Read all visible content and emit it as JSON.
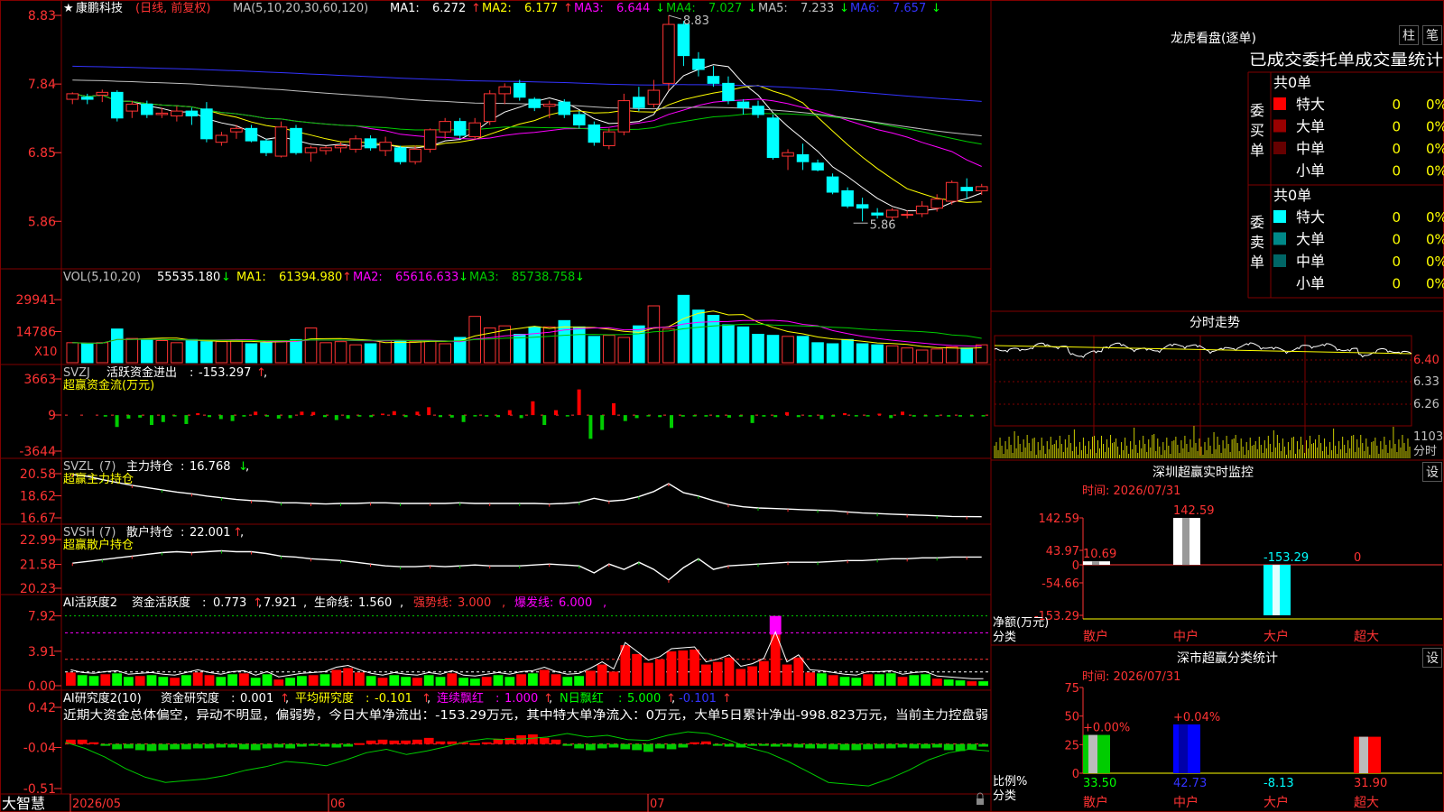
{
  "chart_data": [
    {
      "type": "candlestick",
      "title": "康鹏科技",
      "subtitle": "(日线, 前复权)",
      "legend_prefix": "MA(5,10,20,30,60,120)",
      "ma": [
        {
          "name": "MA1",
          "value": "6.272",
          "dir": "↑",
          "color": "#ffffff"
        },
        {
          "name": "MA2",
          "value": "6.177",
          "dir": "↑",
          "color": "#ffff00"
        },
        {
          "name": "MA3",
          "value": "6.644",
          "dir": "↓",
          "color": "#ff00ff"
        },
        {
          "name": "MA4",
          "value": "7.027",
          "dir": "↓",
          "color": "#00cc00"
        },
        {
          "name": "MA5",
          "value": "7.233",
          "dir": "↓",
          "color": "#c0c0c0"
        },
        {
          "name": "MA6",
          "value": "7.657",
          "dir": "↓",
          "color": "#3333ff"
        }
      ],
      "ylim": [
        5.2,
        9.0
      ],
      "yticks": [
        "8.83",
        "7.84",
        "6.85",
        "5.86"
      ],
      "high_label": "8.83",
      "low_label": "5.86",
      "x_labels": [
        "2026/05",
        "06",
        "07"
      ],
      "candles": [
        [
          7.62,
          7.72,
          7.55,
          7.7
        ],
        [
          7.65,
          7.7,
          7.55,
          7.62
        ],
        [
          7.68,
          7.76,
          7.58,
          7.72
        ],
        [
          7.72,
          7.75,
          7.3,
          7.35
        ],
        [
          7.45,
          7.6,
          7.35,
          7.55
        ],
        [
          7.55,
          7.6,
          7.35,
          7.4
        ],
        [
          7.4,
          7.5,
          7.35,
          7.42
        ],
        [
          7.38,
          7.52,
          7.3,
          7.45
        ],
        [
          7.45,
          7.5,
          7.25,
          7.38
        ],
        [
          7.48,
          7.58,
          7.0,
          7.05
        ],
        [
          7.0,
          7.15,
          6.95,
          7.1
        ],
        [
          7.15,
          7.25,
          7.05,
          7.2
        ],
        [
          7.2,
          7.25,
          7.0,
          7.02
        ],
        [
          7.02,
          7.05,
          6.8,
          6.85
        ],
        [
          6.8,
          7.3,
          6.78,
          7.22
        ],
        [
          7.2,
          7.25,
          6.82,
          6.85
        ],
        [
          6.85,
          6.95,
          6.72,
          6.92
        ],
        [
          6.88,
          6.95,
          6.82,
          6.92
        ],
        [
          6.92,
          7.0,
          6.85,
          6.95
        ],
        [
          6.9,
          7.1,
          6.85,
          7.05
        ],
        [
          7.05,
          7.1,
          6.88,
          6.92
        ],
        [
          6.88,
          7.08,
          6.8,
          7.0
        ],
        [
          6.92,
          6.95,
          6.68,
          6.72
        ],
        [
          6.72,
          6.95,
          6.68,
          6.9
        ],
        [
          6.9,
          7.2,
          6.85,
          7.18
        ],
        [
          7.15,
          7.35,
          7.05,
          7.3
        ],
        [
          7.3,
          7.35,
          7.05,
          7.1
        ],
        [
          7.08,
          7.35,
          7.05,
          7.28
        ],
        [
          7.3,
          7.75,
          7.25,
          7.7
        ],
        [
          7.7,
          7.85,
          7.55,
          7.8
        ],
        [
          7.85,
          7.9,
          7.6,
          7.65
        ],
        [
          7.62,
          7.65,
          7.45,
          7.5
        ],
        [
          7.52,
          7.6,
          7.35,
          7.55
        ],
        [
          7.58,
          7.62,
          7.35,
          7.4
        ],
        [
          7.4,
          7.45,
          7.2,
          7.25
        ],
        [
          7.25,
          7.3,
          6.95,
          7.0
        ],
        [
          6.95,
          7.2,
          6.9,
          7.15
        ],
        [
          7.15,
          7.7,
          7.1,
          7.6
        ],
        [
          7.65,
          7.8,
          7.45,
          7.5
        ],
        [
          7.55,
          7.9,
          7.5,
          7.75
        ],
        [
          7.85,
          8.83,
          7.75,
          8.7
        ],
        [
          8.7,
          8.75,
          8.1,
          8.25
        ],
        [
          8.2,
          8.3,
          7.95,
          8.05
        ],
        [
          7.95,
          8.1,
          7.8,
          7.85
        ],
        [
          7.85,
          7.95,
          7.55,
          7.6
        ],
        [
          7.58,
          7.62,
          7.4,
          7.5
        ],
        [
          7.52,
          7.6,
          7.35,
          7.4
        ],
        [
          7.35,
          7.4,
          6.75,
          6.78
        ],
        [
          6.8,
          6.9,
          6.6,
          6.85
        ],
        [
          6.82,
          6.98,
          6.6,
          6.72
        ],
        [
          6.7,
          6.75,
          6.58,
          6.6
        ],
        [
          6.5,
          6.55,
          6.25,
          6.28
        ],
        [
          6.3,
          6.35,
          6.05,
          6.08
        ],
        [
          6.1,
          6.2,
          5.86,
          6.05
        ],
        [
          5.98,
          6.05,
          5.9,
          5.95
        ],
        [
          5.92,
          6.05,
          5.88,
          6.02
        ],
        [
          5.95,
          6.02,
          5.9,
          5.96
        ],
        [
          5.97,
          6.15,
          5.92,
          6.08
        ],
        [
          6.05,
          6.25,
          6.0,
          6.18
        ],
        [
          6.15,
          6.45,
          6.1,
          6.42
        ],
        [
          6.35,
          6.48,
          6.18,
          6.3
        ],
        [
          6.3,
          6.4,
          6.24,
          6.36
        ]
      ]
    },
    {
      "type": "bar",
      "title": "VOL(5,10,20)",
      "value": "55535.180",
      "value_dir": "↓",
      "ma": [
        {
          "name": "MA1",
          "value": "61394.980",
          "dir": "↑",
          "color": "#ffff00"
        },
        {
          "name": "MA2",
          "value": "65616.633",
          "dir": "↓",
          "color": "#ff00ff"
        },
        {
          "name": "MA3",
          "value": "85738.758",
          "dir": "↓",
          "color": "#00cc00"
        }
      ],
      "yticks": [
        "29941",
        "14786"
      ],
      "unit_label": "X10",
      "ylim": [
        0,
        36000
      ],
      "values": [
        9500,
        9000,
        9500,
        16000,
        11500,
        11000,
        10500,
        9500,
        11000,
        10000,
        10000,
        10500,
        9000,
        9500,
        10500,
        11000,
        16500,
        9500,
        10000,
        8500,
        9000,
        10500,
        10500,
        10000,
        10500,
        9000,
        12000,
        22000,
        16500,
        17500,
        13500,
        17000,
        17000,
        20000,
        17000,
        12500,
        13000,
        12000,
        17500,
        27000,
        16000,
        32000,
        25000,
        22500,
        18000,
        17000,
        13500,
        13000,
        12500,
        12500,
        9500,
        9000,
        11000,
        9000,
        8500,
        8000,
        7000,
        6000,
        6500,
        7500,
        7000,
        8500
      ]
    },
    {
      "type": "bar",
      "title": "SVZJ",
      "label": "活跃资金进出",
      "value": "-153.297",
      "value_dir": "↑",
      "subtitle": "超赢资金流(万元)",
      "yticks": [
        "3663",
        "9",
        "-3644"
      ],
      "ylim": [
        -3644,
        3663
      ],
      "values": [
        0,
        0,
        0,
        -150,
        -1200,
        -350,
        -250,
        -1000,
        -700,
        -100,
        -900,
        200,
        -200,
        -400,
        -600,
        -150,
        350,
        -150,
        -350,
        -300,
        350,
        320,
        -200,
        -500,
        -350,
        -150,
        -200,
        150,
        400,
        -200,
        350,
        800,
        -200,
        -250,
        -700,
        -100,
        -150,
        -200,
        500,
        -300,
        1400,
        -1000,
        500,
        -100,
        2600,
        -2400,
        -1500,
        1200,
        -600,
        -300,
        -100,
        -200,
        -1300,
        -150,
        -100,
        -150,
        -200,
        -250,
        -150,
        -800,
        -150,
        -200,
        300,
        -200,
        -150,
        -400,
        -150,
        200,
        -100,
        -100,
        150,
        -300,
        350,
        -150,
        -100,
        -100,
        -150,
        -150,
        -100,
        -100
      ]
    },
    {
      "type": "line",
      "title": "SVZL",
      "param": "(7)",
      "label": "主力持仓",
      "value": "16.768",
      "value_dir": "↓",
      "subtitle": "超赢主力持仓",
      "yticks": [
        "20.58",
        "18.62",
        "16.67"
      ],
      "ylim": [
        16.67,
        20.58
      ],
      "values": [
        20.5,
        20.35,
        20.05,
        19.8,
        19.55,
        19.35,
        19.15,
        18.95,
        18.8,
        18.6,
        18.45,
        18.3,
        18.2,
        18.15,
        18.0,
        18.0,
        17.95,
        17.9,
        17.95,
        17.95,
        18.0,
        18.0,
        17.95,
        17.95,
        17.95,
        17.95,
        18.0,
        17.95,
        17.95,
        17.95,
        17.95,
        17.95,
        17.9,
        17.95,
        18.05,
        18.4,
        18.15,
        18.25,
        18.55,
        19.0,
        19.7,
        18.9,
        18.6,
        18.2,
        17.85,
        17.65,
        17.55,
        17.5,
        17.45,
        17.4,
        17.35,
        17.3,
        17.2,
        17.1,
        17.05,
        17.0,
        16.95,
        16.9,
        16.85,
        16.8,
        16.78,
        16.77
      ]
    },
    {
      "type": "line",
      "title": "SVSH",
      "param": "(7)",
      "label": "散户持仓",
      "value": "22.001",
      "value_dir": "↑",
      "subtitle": "超赢散户持仓",
      "yticks": [
        "22.99",
        "21.58",
        "20.23"
      ],
      "ylim": [
        20.23,
        22.99
      ],
      "values": [
        21.65,
        21.75,
        21.85,
        21.95,
        22.05,
        22.15,
        22.25,
        22.3,
        22.25,
        22.3,
        22.35,
        22.3,
        22.3,
        22.2,
        22.05,
        22.0,
        21.9,
        21.85,
        21.8,
        21.7,
        21.6,
        21.5,
        21.45,
        21.45,
        21.5,
        21.45,
        21.5,
        21.55,
        21.5,
        21.5,
        21.5,
        21.55,
        21.6,
        21.55,
        21.5,
        21.1,
        21.6,
        21.3,
        21.7,
        21.3,
        20.7,
        21.4,
        21.9,
        21.3,
        21.5,
        21.55,
        21.6,
        21.65,
        21.7,
        21.7,
        21.7,
        21.75,
        21.8,
        21.8,
        21.85,
        21.9,
        21.9,
        21.95,
        21.95,
        22.0,
        22.0,
        22.0
      ]
    },
    {
      "type": "bar",
      "title": "AI活跃度2",
      "label": "资金活跃度",
      "value": "0.773",
      "value_dir": "↑",
      "v2": "7.921",
      "life_label": "生命线",
      "life": "1.560",
      "strong_label": "强势线",
      "strong": "3.000",
      "burst_label": "爆发线",
      "burst": "6.000",
      "yticks": [
        "7.92",
        "3.91",
        "0.00"
      ],
      "ylim": [
        0,
        8.5
      ],
      "values": [
        1.5,
        1.2,
        1.1,
        1.3,
        1.4,
        1.0,
        1.1,
        1.2,
        1.0,
        0.9,
        1.2,
        1.5,
        1.2,
        1.0,
        1.3,
        1.4,
        0.9,
        1.3,
        0.7,
        0.9,
        1.1,
        1.2,
        1.3,
        1.8,
        2.0,
        1.5,
        1.1,
        0.9,
        1.2,
        1.0,
        0.9,
        1.2,
        1.0,
        1.4,
        0.9,
        0.8,
        1.0,
        1.2,
        1.0,
        1.3,
        1.4,
        1.8,
        1.3,
        1.0,
        1.1,
        1.7,
        2.4,
        1.6,
        4.6,
        3.6,
        2.6,
        3.0,
        3.9,
        4.0,
        4.1,
        2.4,
        2.7,
        3.2,
        1.9,
        2.2,
        2.8,
        5.8,
        2.4,
        3.2,
        1.5,
        1.4,
        1.2,
        1.0,
        0.9,
        1.3,
        1.3,
        1.4,
        1.0,
        1.2,
        1.3,
        0.8,
        0.7,
        0.6,
        0.5,
        0.5
      ]
    },
    {
      "type": "bar",
      "title": "AI研究度2(10)",
      "label": "资金研究度",
      "value": "0.001",
      "value_dir": "↑",
      "avg_label": "平均研究度",
      "avg": "-0.101",
      "avg_dir": "↑",
      "streak_label": "连续飘红",
      "streak": "1.000",
      "streak_dir": "↑",
      "nday_label": "N日飘红",
      "nday": "5.000",
      "nday_dir": "↑",
      "last": "-0.101",
      "last_dir": "↑",
      "yticks": [
        "0.42",
        "-0.04",
        "-0.51"
      ],
      "ylim": [
        -0.51,
        0.42
      ],
      "note": "近期大资金总体偏空，异动不明显，偏弱势，今日大单净流出：-153.29万元，其中特大单净流入：0万元，大单5日累计净出-998.823万元，当前主力控盘弱",
      "values": [
        0.05,
        0.05,
        0.02,
        -0.02,
        -0.06,
        -0.05,
        -0.07,
        -0.08,
        -0.07,
        -0.06,
        -0.06,
        -0.05,
        -0.05,
        -0.04,
        -0.04,
        -0.06,
        -0.07,
        -0.05,
        -0.04,
        -0.05,
        -0.03,
        -0.02,
        -0.03,
        -0.04,
        -0.03,
        0.01,
        0.04,
        0.05,
        0.04,
        0.04,
        0.05,
        0.07,
        0.03,
        0.03,
        0.02,
        0.01,
        0.02,
        0.06,
        0.07,
        0.1,
        0.11,
        0.07,
        0.05,
        -0.02,
        -0.05,
        -0.07,
        -0.05,
        -0.04,
        -0.06,
        -0.07,
        -0.09,
        -0.05,
        -0.06,
        -0.04,
        0.02,
        0.03,
        0.0,
        -0.03,
        -0.04,
        -0.02,
        -0.02,
        -0.03,
        -0.03,
        -0.04,
        -0.05,
        -0.05,
        -0.06,
        -0.07,
        -0.07,
        -0.06,
        -0.05,
        -0.05,
        -0.04,
        -0.05,
        -0.05,
        -0.04,
        -0.07,
        -0.08,
        -0.06,
        -0.03
      ]
    },
    {
      "type": "line",
      "title": "分时走势",
      "yticks": [
        "6.40",
        "6.33",
        "6.26"
      ],
      "volume_label": "1103",
      "volume_unit": "分时"
    },
    {
      "type": "bar",
      "title": "深圳超赢实时监控",
      "time": "时间: 2026/07/31",
      "ylabel": "净额(万元)",
      "xlabel": "分类",
      "yticks": [
        "142.59",
        "43.97",
        "0",
        "-54.66",
        "-153.29"
      ],
      "ylim": [
        -153.29,
        142.59
      ],
      "categories": [
        "散户",
        "中户",
        "大户",
        "超大"
      ],
      "values": [
        10.69,
        142.59,
        -153.29,
        0
      ],
      "value_labels": [
        "10.69",
        "142.59",
        "-153.29",
        "0"
      ],
      "colors": [
        "#ffffff",
        "#ffffff",
        "#00ffff",
        "#ff0000"
      ]
    },
    {
      "type": "bar",
      "title": "深市超赢分类统计",
      "time": "时间: 2026/07/31",
      "ylabel": "比例%",
      "xlabel": "分类",
      "yticks": [
        "75",
        "50",
        "25",
        "0"
      ],
      "ylim": [
        0,
        75
      ],
      "categories": [
        "散户",
        "中户",
        "大户",
        "超大"
      ],
      "values": [
        33.5,
        42.73,
        -8.13,
        31.9
      ],
      "value_labels": [
        "33.50",
        "42.73",
        "-8.13",
        "31.90"
      ],
      "change_labels": [
        "+0.00%",
        "+0.04%",
        "",
        ""
      ],
      "colors": [
        "#00cc00",
        "#0000ff",
        "#00ffff",
        "#ff0000"
      ]
    }
  ],
  "footer": {
    "brand": "大智慧"
  },
  "right_panel": {
    "title": "龙虎看盘(逐单)",
    "btn_bar": "柱",
    "btn_pen": "笔",
    "header": "已成交委托单成交量统计",
    "buy_group_label": "委买单",
    "sell_group_label": "委卖单",
    "buy_total": "共0单",
    "sell_total": "共0单",
    "buy_rows": [
      {
        "label": "特大",
        "value": "0",
        "pct": "0%",
        "color": "#ff0000"
      },
      {
        "label": "大单",
        "value": "0",
        "pct": "0%",
        "color": "#990000"
      },
      {
        "label": "中单",
        "value": "0",
        "pct": "0%",
        "color": "#660000"
      },
      {
        "label": "小单",
        "value": "0",
        "pct": "0%",
        "color": ""
      }
    ],
    "sell_rows": [
      {
        "label": "特大",
        "value": "0",
        "pct": "0%",
        "color": "#00ffff"
      },
      {
        "label": "大单",
        "value": "0",
        "pct": "0%",
        "color": "#008888"
      },
      {
        "label": "中单",
        "value": "0",
        "pct": "0%",
        "color": "#006666"
      },
      {
        "label": "小单",
        "value": "0",
        "pct": "0%",
        "color": ""
      }
    ],
    "settings_label": "设"
  }
}
